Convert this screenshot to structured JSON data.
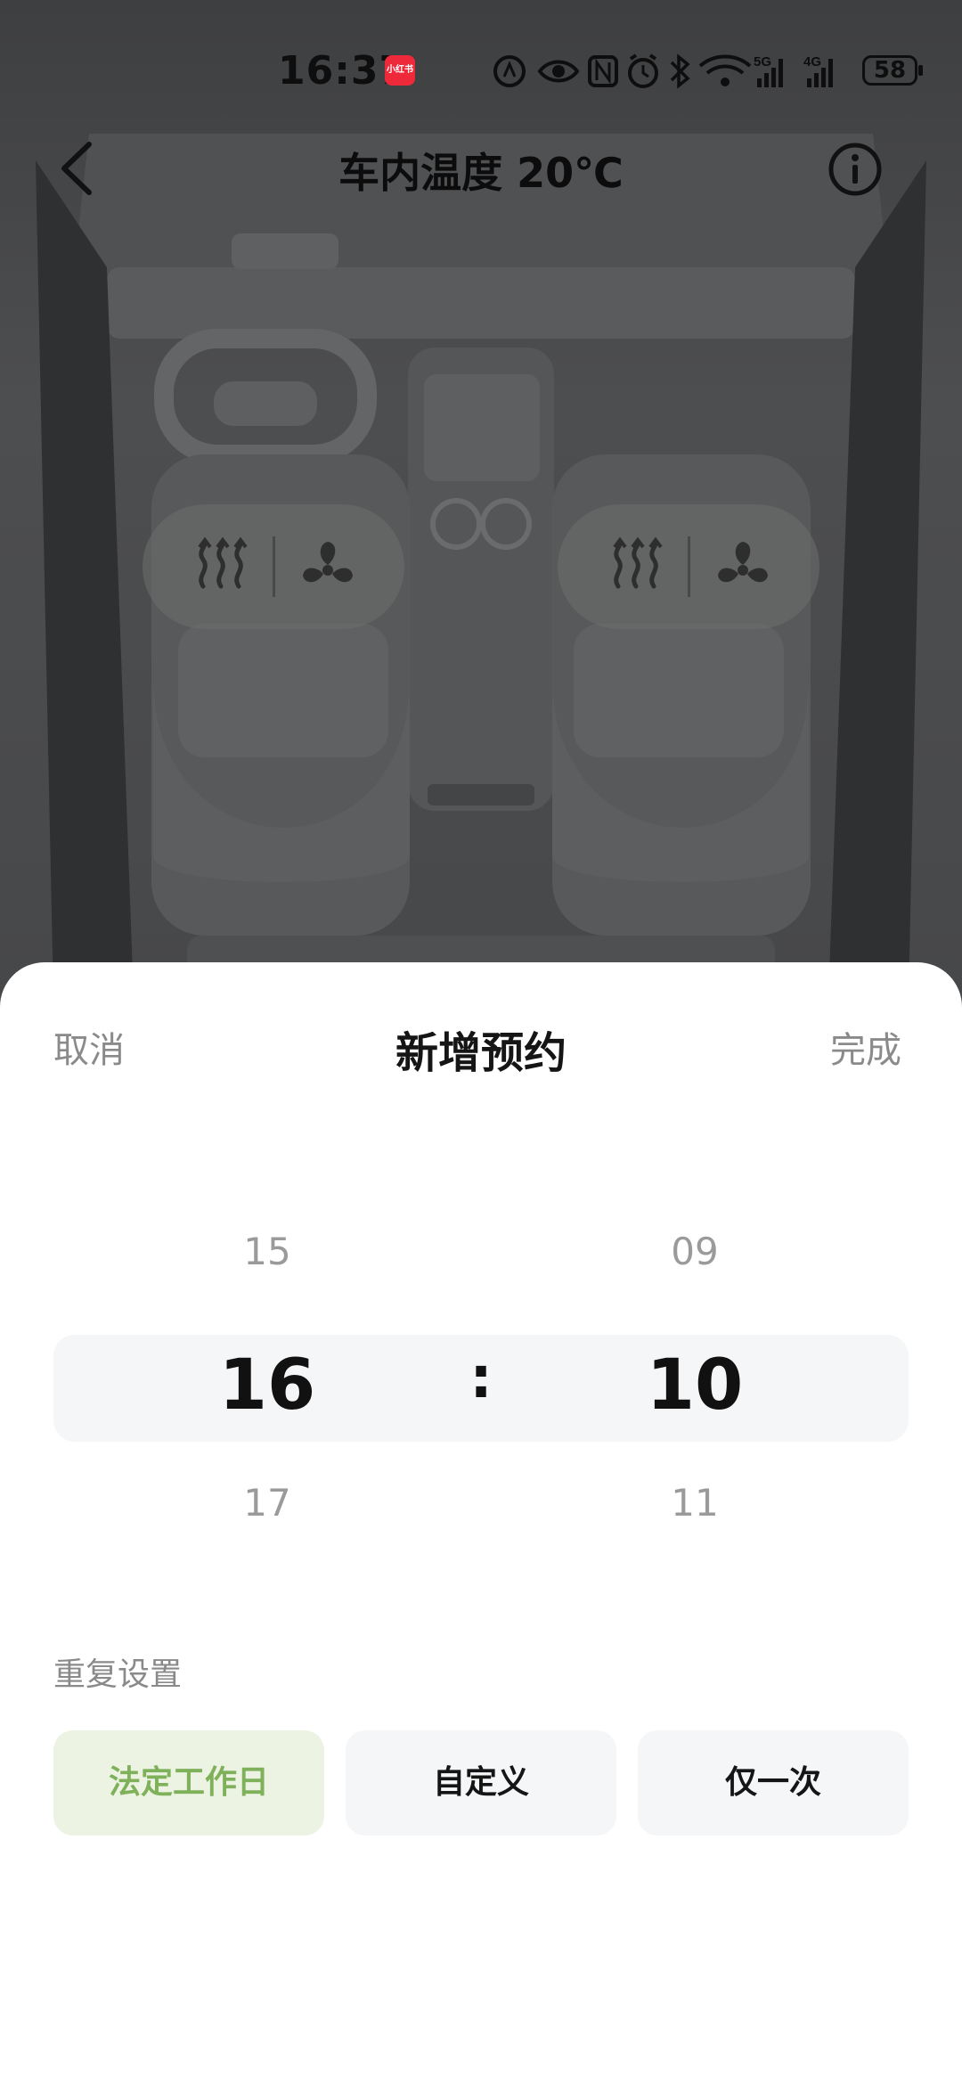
{
  "status_bar": {
    "time": "16:37",
    "notification_badge": "小红书",
    "icons": [
      "nfc-leaf-icon",
      "eye-icon",
      "nfc-icon",
      "alarm-icon",
      "bluetooth-icon",
      "wifi-icon",
      "signal-5g-icon",
      "signal-4g-icon"
    ],
    "network_1": "5G",
    "network_2": "4G",
    "battery": "58"
  },
  "header": {
    "title": "车内温度 20℃"
  },
  "seats": {
    "left": {
      "heat_icon": "seat-heat-icon",
      "fan_icon": "seat-fan-icon"
    },
    "right": {
      "heat_icon": "seat-heat-icon",
      "fan_icon": "seat-fan-icon"
    }
  },
  "sheet": {
    "cancel": "取消",
    "title": "新增预约",
    "done": "完成",
    "picker": {
      "hours": {
        "prev": "15",
        "selected": "16",
        "next": "17"
      },
      "separator": ":",
      "minutes": {
        "prev": "09",
        "selected": "10",
        "next": "11"
      }
    },
    "repeat_label": "重复设置",
    "repeat_options": [
      {
        "label": "法定工作日",
        "active": true
      },
      {
        "label": "自定义",
        "active": false
      },
      {
        "label": "仅一次",
        "active": false
      }
    ]
  },
  "colors": {
    "active_green": "#7fb05a",
    "active_bg": "#ecf3e3",
    "notif_red": "#ee2a3a"
  }
}
